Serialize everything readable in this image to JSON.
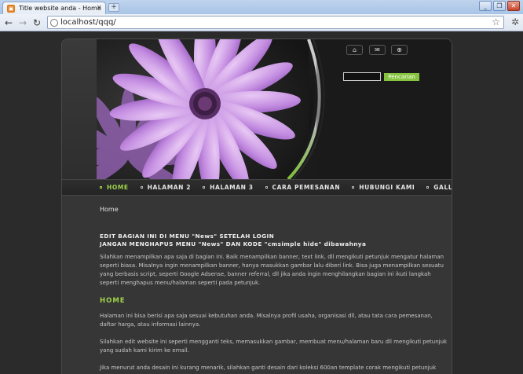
{
  "browser": {
    "tab_title": "Title website anda - Home",
    "tab_close": "×",
    "new_tab": "+",
    "url": "localhost/qqq/",
    "window_buttons": [
      "_",
      "❐",
      "✕"
    ],
    "nav_icons": {
      "back": "←",
      "forward": "→",
      "reload": "↻",
      "star": "☆",
      "wrench": "🔧"
    }
  },
  "header": {
    "icon_buttons": [
      "⌂",
      "✉",
      "⊕"
    ],
    "search_placeholder": "",
    "search_button": "Pencarian"
  },
  "nav": {
    "items": [
      {
        "label": "HOME",
        "active": true
      },
      {
        "label": "HALAMAN 2",
        "active": false
      },
      {
        "label": "HALAMAN 3",
        "active": false
      },
      {
        "label": "CARA PEMESANAN",
        "active": false
      },
      {
        "label": "HUBUNGI KAMI",
        "active": false
      },
      {
        "label": "GALLERY FOTO",
        "active": false
      }
    ]
  },
  "content": {
    "breadcrumb": "Home",
    "heading_line1": "EDIT BAGIAN INI DI MENU \"News\" SETELAH LOGIN",
    "heading_line2": "JANGAN MENGHAPUS MENU \"News\" DAN KODE \"cmsimple hide\" dibawahnya",
    "para1": "Silahkan menampilkan apa saja di bagian ini. Baik menampilkan banner, text link, dll mengikuti petunjuk mengatur halaman seperti biasa. Misalnya ingin menampilkan banner, hanya masukkan gambar lalu diberi link. Bisa juga menampilkan sesuatu yang berbasis script, seperti Google Adsense, banner referral, dll jika anda ingin menghilangkan bagian ini ikuti langkah seperti menghapus menu/halaman seperti pada petunjuk.",
    "section_title": "HOME",
    "para2": "Halaman ini bisa berisi apa saja sesuai kebutuhan anda. Misalnya profil usaha, organisasi dll, atau tata cara pemesanan, daftar harga, atau informasi lainnya.",
    "para3": "Silahkan edit website ini seperti mengganti teks, memasukkan gambar, membuat menu/halaman baru dll mengikuti petunjuk yang sudah kami kirim ke email.",
    "para4": "Jika menurut anda desain ini kurang menarik, silahkan ganti desain dari koleksi 600an template corak mengikuti petunjuk"
  },
  "colors": {
    "accent_green": "#9ed34a",
    "button_green": "#86c340",
    "flower_purple": "#c089e0",
    "background": "#2b2b2b"
  }
}
